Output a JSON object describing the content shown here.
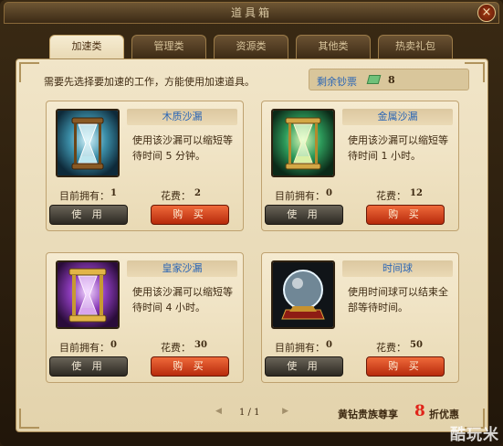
{
  "window": {
    "title": "道具箱",
    "close_label": "×"
  },
  "tabs": [
    {
      "label": "加速类",
      "active": true
    },
    {
      "label": "管理类"
    },
    {
      "label": "资源类"
    },
    {
      "label": "其他类"
    },
    {
      "label": "热卖礼包"
    }
  ],
  "hint": "需要先选择要加速的工作，方能使用加速道具。",
  "banknotes": {
    "label": "剩余钞票",
    "value": "8",
    "icon": "banknote-icon"
  },
  "items": [
    {
      "name": "木质沙漏",
      "desc": "使用该沙漏可以缩短等待时间 5 分钟。",
      "owned_label": "目前拥有：",
      "owned": "1",
      "cost_label": "花费：",
      "cost": "2",
      "use_label": "使 用",
      "buy_label": "购 买",
      "icon": "wooden-hourglass-icon",
      "accent": "#6ec6e0"
    },
    {
      "name": "金属沙漏",
      "desc": "使用该沙漏可以缩短等待时间 1 小时。",
      "owned_label": "目前拥有：",
      "owned": "0",
      "cost_label": "花费：",
      "cost": "12",
      "use_label": "使 用",
      "buy_label": "购 买",
      "icon": "metal-hourglass-icon",
      "accent": "#48c873"
    },
    {
      "name": "皇家沙漏",
      "desc": "使用该沙漏可以缩短等待时间 4 小时。",
      "owned_label": "目前拥有：",
      "owned": "0",
      "cost_label": "花费：",
      "cost": "30",
      "use_label": "使 用",
      "buy_label": "购 买",
      "icon": "royal-hourglass-icon",
      "accent": "#c77ee0"
    },
    {
      "name": "时间球",
      "desc": "使用时间球可以结束全部等待时间。",
      "owned_label": "目前拥有：",
      "owned": "0",
      "cost_label": "花费：",
      "cost": "50",
      "use_label": "使 用",
      "buy_label": "购 买",
      "icon": "time-orb-icon",
      "accent": "#8fd0ff"
    }
  ],
  "pager": {
    "prev": "◀",
    "text": "1 / 1",
    "next": "▶"
  },
  "promo": {
    "prefix": "黄钻贵族尊享",
    "number": "8",
    "suffix": "折优惠"
  },
  "watermark": "酷玩米"
}
